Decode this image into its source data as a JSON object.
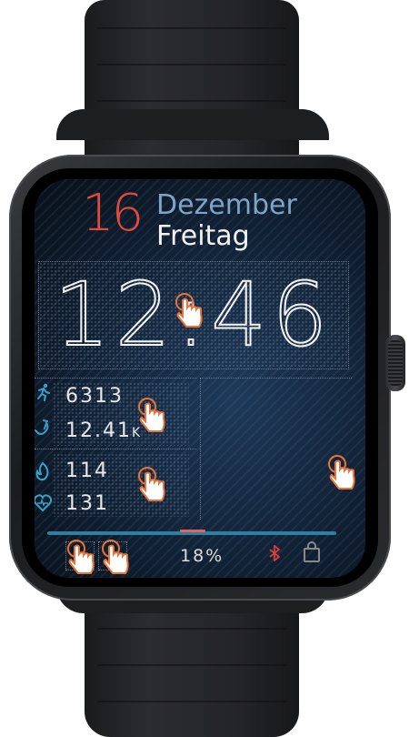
{
  "date": {
    "day": "16",
    "month": "Dezember",
    "weekday": "Freitag"
  },
  "time": {
    "hours": "12",
    "minutes": "46",
    "separator": ":"
  },
  "stats": {
    "steps": "6313",
    "distance": "12.41",
    "distance_unit": "K",
    "calories": "114",
    "heart_rate": "131"
  },
  "status": {
    "battery": "18%"
  },
  "icons": {
    "steps": "runner-icon",
    "distance": "distance-icon",
    "calories": "flame-icon",
    "heart": "heart-icon",
    "bluetooth": "bluetooth-icon",
    "lock": "lock-icon",
    "tap_hint": "tap-hand-icon"
  },
  "colors": {
    "day": "#e14b3c",
    "month": "#7ea4c6",
    "accent": "#3aa0c8",
    "bluetooth": "#d83c3c",
    "tap_hint": "#e8733a"
  }
}
